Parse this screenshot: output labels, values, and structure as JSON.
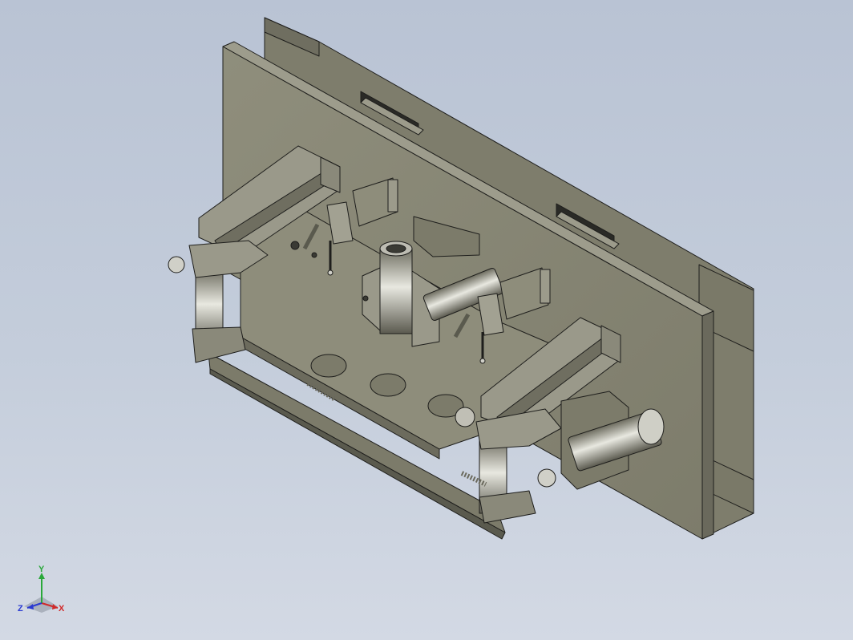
{
  "viewport": {
    "background_top": "#b9c3d4",
    "background_bottom": "#d3d9e4"
  },
  "model": {
    "part_color": "#8c8b79",
    "part_shadow": "#6f6e60",
    "edge_color": "#1e1e1c",
    "highlight": "#c9c9c0"
  },
  "triad": {
    "x_label": "X",
    "y_label": "Y",
    "z_label": "Z",
    "x_color": "#d12a2a",
    "y_color": "#2aa83a",
    "z_color": "#2a3ad1"
  }
}
